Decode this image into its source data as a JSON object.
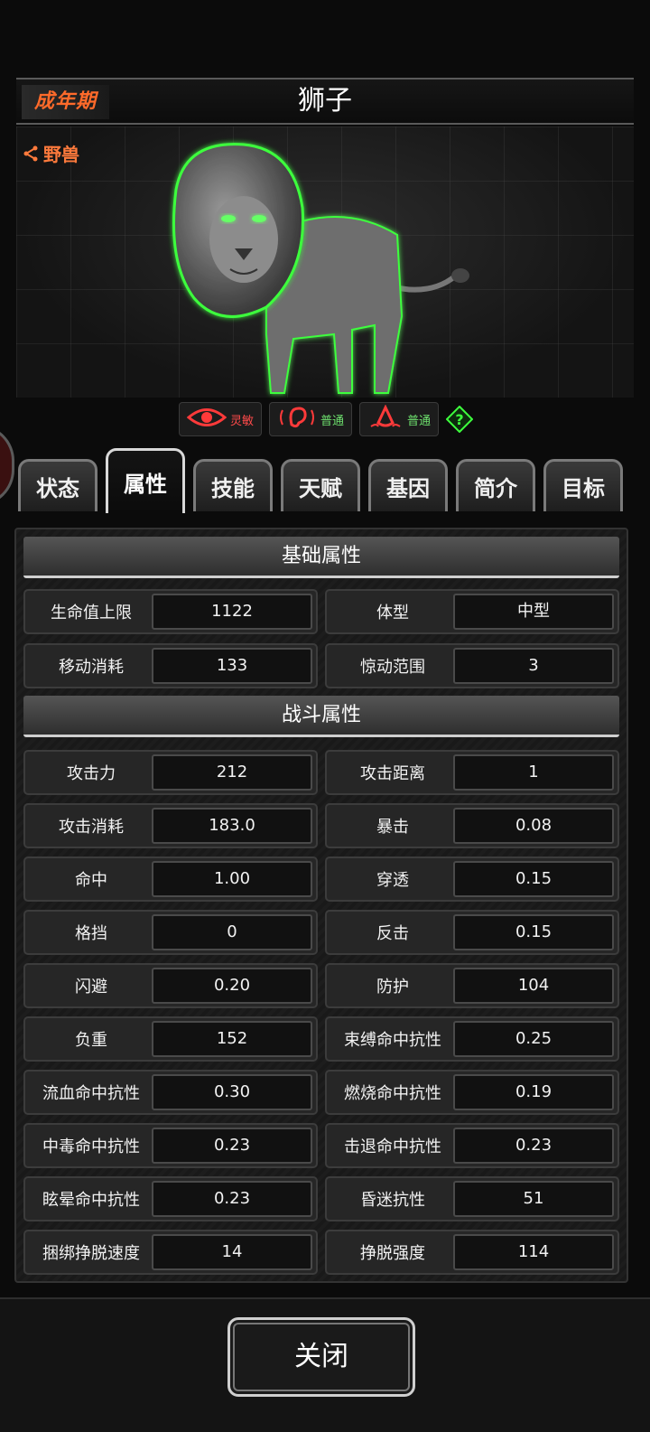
{
  "header": {
    "stage_badge": "成年期",
    "title": "狮子",
    "category": "野兽"
  },
  "traits": [
    {
      "label": "灵敏",
      "icon": "eye-icon",
      "color": "#ff4a4a"
    },
    {
      "label": "普通",
      "icon": "ear-icon",
      "color": "#6ee06e"
    },
    {
      "label": "普通",
      "icon": "nose-icon",
      "color": "#6ee06e"
    }
  ],
  "help_icon": "question-icon",
  "tabs": [
    "状态",
    "属性",
    "技能",
    "天赋",
    "基因",
    "简介",
    "目标"
  ],
  "active_tab": "属性",
  "sections": {
    "basic": {
      "title": "基础属性",
      "rows": [
        [
          {
            "k": "生命值上限",
            "v": "1122"
          },
          {
            "k": "体型",
            "v": "中型"
          }
        ],
        [
          {
            "k": "移动消耗",
            "v": "133"
          },
          {
            "k": "惊动范围",
            "v": "3"
          }
        ]
      ]
    },
    "combat": {
      "title": "战斗属性",
      "rows": [
        [
          {
            "k": "攻击力",
            "v": "212"
          },
          {
            "k": "攻击距离",
            "v": "1"
          }
        ],
        [
          {
            "k": "攻击消耗",
            "v": "183.0"
          },
          {
            "k": "暴击",
            "v": "0.08"
          }
        ],
        [
          {
            "k": "命中",
            "v": "1.00"
          },
          {
            "k": "穿透",
            "v": "0.15"
          }
        ],
        [
          {
            "k": "格挡",
            "v": "0"
          },
          {
            "k": "反击",
            "v": "0.15"
          }
        ],
        [
          {
            "k": "闪避",
            "v": "0.20"
          },
          {
            "k": "防护",
            "v": "104"
          }
        ],
        [
          {
            "k": "负重",
            "v": "152"
          },
          {
            "k": "束缚命中抗性",
            "v": "0.25"
          }
        ],
        [
          {
            "k": "流血命中抗性",
            "v": "0.30"
          },
          {
            "k": "燃烧命中抗性",
            "v": "0.19"
          }
        ],
        [
          {
            "k": "中毒命中抗性",
            "v": "0.23"
          },
          {
            "k": "击退命中抗性",
            "v": "0.23"
          }
        ],
        [
          {
            "k": "眩晕命中抗性",
            "v": "0.23"
          },
          {
            "k": "昏迷抗性",
            "v": "51"
          }
        ],
        [
          {
            "k": "捆绑挣脱速度",
            "v": "14"
          },
          {
            "k": "挣脱强度",
            "v": "114"
          }
        ]
      ]
    }
  },
  "close_label": "关闭",
  "colors": {
    "accent": "#ff6a2a",
    "green_glow": "#3dff3d"
  }
}
